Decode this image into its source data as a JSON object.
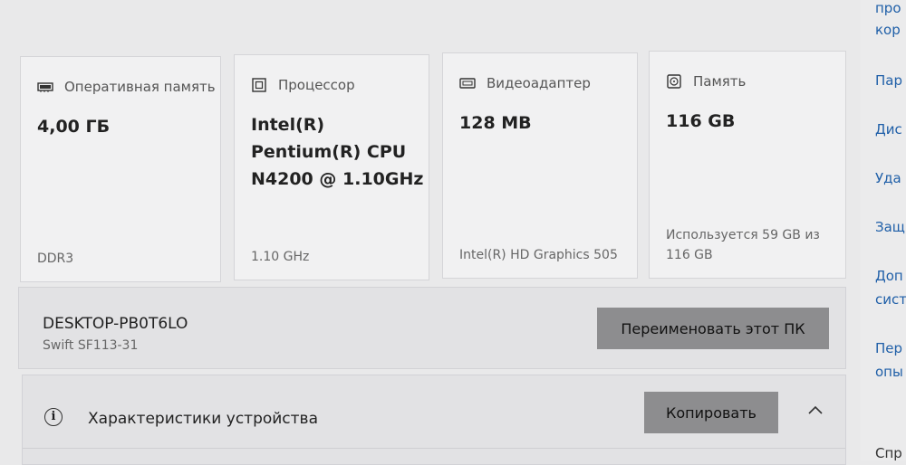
{
  "cards": [
    {
      "title": "Оперативная память",
      "icon": "ram-icon",
      "value": "4,00 ГБ",
      "sub": "DDR3"
    },
    {
      "title": "Процессор",
      "icon": "cpu-icon",
      "value_lines": [
        "Intel(R)",
        "Pentium(R) CPU",
        "N4200 @ 1.10GHz"
      ],
      "sub": "1.10 GHz"
    },
    {
      "title": "Видеоадаптер",
      "icon": "gpu-icon",
      "value": "128 MB",
      "sub": "Intel(R) HD Graphics 505"
    },
    {
      "title": "Память",
      "icon": "storage-icon",
      "value": "116 GB",
      "sub_lines": [
        "Используется 59 GB из",
        "116 GB"
      ]
    }
  ],
  "pc": {
    "name": "DESKTOP-PB0T6LO",
    "model": "Swift SF113-31",
    "rename_label": "Переименовать этот ПК"
  },
  "specs": {
    "title": "Характеристики устройства",
    "copy_label": "Копировать",
    "info_symbol": "i"
  },
  "sidebar": {
    "items": [
      "про",
      "кор",
      "Пар",
      "Дис",
      "Уда",
      "Защ",
      "Доп",
      "сист",
      "Пер",
      "опы",
      "Спр"
    ]
  },
  "colors": {
    "background": "#e9e9ea",
    "card": "#f1f1f2",
    "button": "#8d8d8f",
    "link": "#1f5fa8"
  }
}
